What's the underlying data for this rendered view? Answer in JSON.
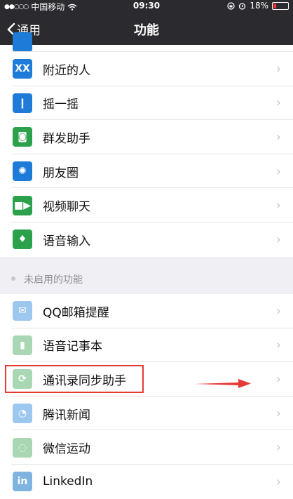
{
  "status": {
    "carrier": "中国移动",
    "time": "09:30",
    "battery": "18%",
    "battery_level": 0.18
  },
  "navbar": {
    "back_label": "通用",
    "title": "功能"
  },
  "enabled": [
    {
      "label": "附近的人",
      "icon": "people-nearby-icon",
      "color": "#1e7bd8"
    },
    {
      "label": "摇一摇",
      "icon": "shake-icon",
      "color": "#1e7bd8"
    },
    {
      "label": "群发助手",
      "icon": "broadcast-icon",
      "color": "#2aa14a"
    },
    {
      "label": "朋友圈",
      "icon": "moments-icon",
      "color": "#1e7bd8"
    },
    {
      "label": "视频聊天",
      "icon": "video-chat-icon",
      "color": "#2aa14a"
    },
    {
      "label": "语音输入",
      "icon": "voice-input-icon",
      "color": "#2aa14a"
    }
  ],
  "section_label": "未启用的功能",
  "disabled": [
    {
      "label": "QQ邮箱提醒",
      "icon": "mail-icon",
      "color": "#9cc7ee"
    },
    {
      "label": "语音记事本",
      "icon": "voice-notebook-icon",
      "color": "#a9d7b3"
    },
    {
      "label": "通讯录同步助手",
      "icon": "contacts-sync-icon",
      "color": "#a9d7b3"
    },
    {
      "label": "腾讯新闻",
      "icon": "tencent-news-icon",
      "color": "#9cc7ee"
    },
    {
      "label": "微信运动",
      "icon": "wechat-sport-icon",
      "color": "#a9d7b3"
    },
    {
      "label": "LinkedIn",
      "icon": "linkedin-icon",
      "color": "#7fb3e0"
    }
  ],
  "annotation_color": "#e53935"
}
